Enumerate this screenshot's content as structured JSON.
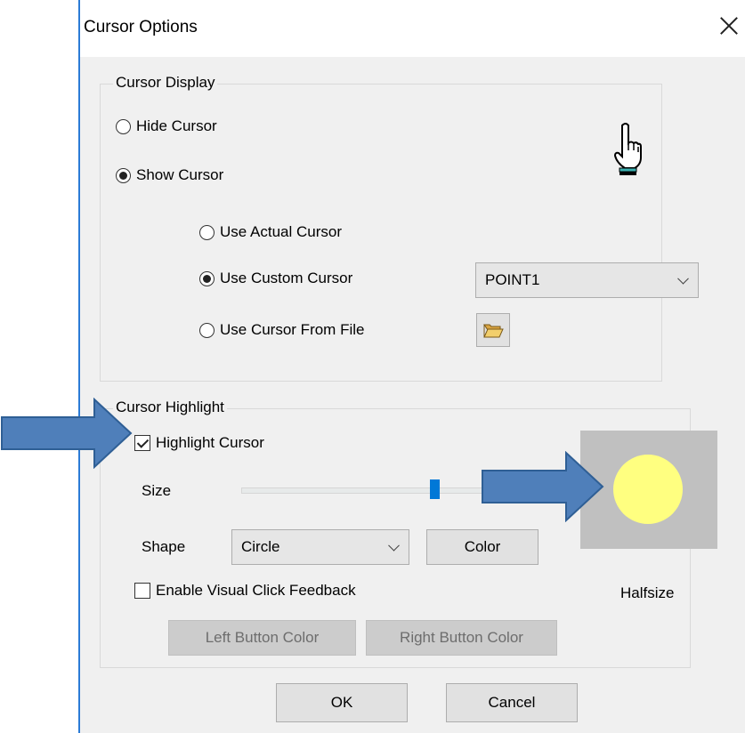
{
  "window": {
    "title": "Cursor Options"
  },
  "cursor_display": {
    "group_label": "Cursor Display",
    "hide_label": "Hide Cursor",
    "show_label": "Show Cursor",
    "actual_label": "Use Actual Cursor",
    "custom_label": "Use Custom Cursor",
    "file_label": "Use Cursor From File",
    "custom_select_value": "POINT1",
    "selected_mode": "Show Cursor",
    "selected_source": "Use Custom Cursor"
  },
  "cursor_highlight": {
    "group_label": "Cursor Highlight",
    "highlight_label": "Highlight Cursor",
    "highlight_checked": true,
    "size_label": "Size",
    "size_value": 0.79,
    "shape_label": "Shape",
    "shape_value": "Circle",
    "color_button": "Color",
    "feedback_label": "Enable Visual Click Feedback",
    "feedback_checked": false,
    "preview_caption": "Halfsize",
    "highlight_color": "#ffff80",
    "left_button": "Left Button Color",
    "right_button": "Right Button Color"
  },
  "footer": {
    "ok": "OK",
    "cancel": "Cancel"
  },
  "annotations": {
    "arrow_color": "#4f7fba"
  }
}
